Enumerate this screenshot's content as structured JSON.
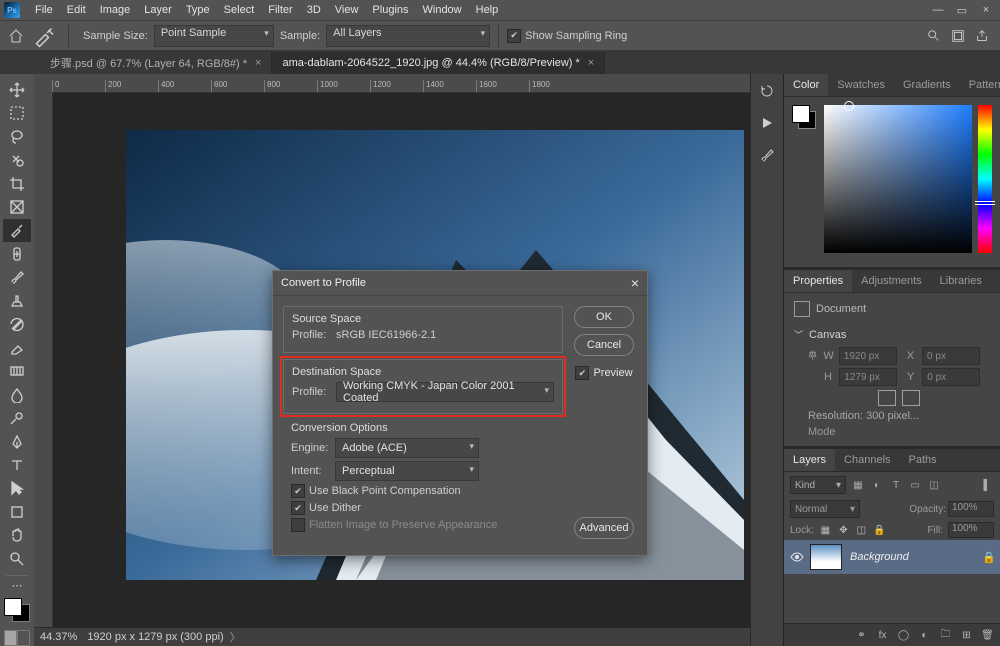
{
  "menubar": [
    "File",
    "Edit",
    "Image",
    "Layer",
    "Type",
    "Select",
    "Filter",
    "3D",
    "View",
    "Plugins",
    "Window",
    "Help"
  ],
  "window_buttons": {
    "min": "—",
    "max": "▭",
    "close": "×"
  },
  "options": {
    "sample_size_label": "Sample Size:",
    "sample_size_value": "Point Sample",
    "sample_label": "Sample:",
    "sample_value": "All Layers",
    "show_sampling_ring": "Show Sampling Ring"
  },
  "tabs": [
    {
      "label": "步骤.psd @ 67.7% (Layer 64, RGB/8#) *",
      "active": false
    },
    {
      "label": "ama-dablam-2064522_1920.jpg @ 44.4% (RGB/8/Preview) *",
      "active": true
    }
  ],
  "ruler_marks": [
    0,
    200,
    400,
    600,
    800,
    1000,
    1200,
    1400,
    1600,
    1800
  ],
  "statusbar": {
    "zoom": "44.37%",
    "info": "1920 px x 1279 px (300 ppi)"
  },
  "right_collapsed_icons": [
    "history-icon",
    "play-icon",
    "brush-icon"
  ],
  "panels": {
    "colorTabs": [
      "Color",
      "Swatches",
      "Gradients",
      "Patterns"
    ],
    "propTabs": [
      "Properties",
      "Adjustments",
      "Libraries"
    ],
    "layerTabs": [
      "Layers",
      "Channels",
      "Paths"
    ]
  },
  "properties": {
    "document_label": "Document",
    "canvas_label": "Canvas",
    "W": "1920 px",
    "X": "0 px",
    "H": "1279 px",
    "Y": "0 px",
    "resolution": "Resolution: 300 pixel...",
    "mode": "Mode"
  },
  "layers": {
    "kind": "Kind",
    "blend": "Normal",
    "opacity_label": "Opacity:",
    "opacity": "100%",
    "lock_label": "Lock:",
    "fill_label": "Fill:",
    "fill": "100%",
    "layer_name": "Background"
  },
  "dialog": {
    "title": "Convert to Profile",
    "source_group": "Source Space",
    "profile_label": "Profile:",
    "source_profile": "sRGB IEC61966-2.1",
    "dest_group": "Destination Space",
    "dest_profile": "Working CMYK - Japan Color 2001 Coated",
    "conv_group": "Conversion Options",
    "engine_label": "Engine:",
    "engine": "Adobe (ACE)",
    "intent_label": "Intent:",
    "intent": "Perceptual",
    "bpc": "Use Black Point Compensation",
    "dither": "Use Dither",
    "flatten": "Flatten Image to Preserve Appearance",
    "ok": "OK",
    "cancel": "Cancel",
    "preview": "Preview",
    "advanced": "Advanced"
  }
}
